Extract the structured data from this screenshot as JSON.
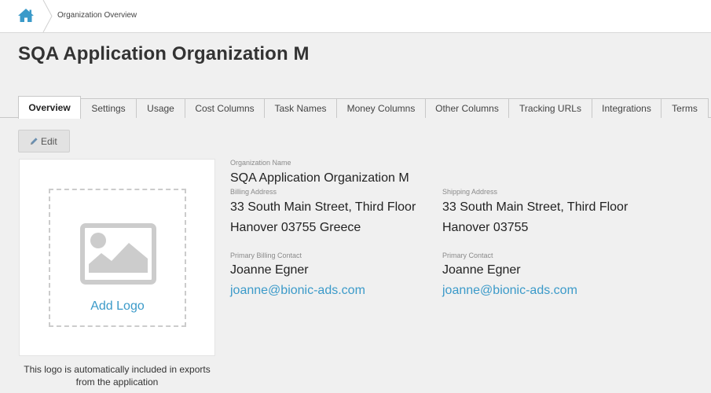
{
  "breadcrumb": {
    "home_icon": "home-icon",
    "current": "Organization Overview"
  },
  "page": {
    "title": "SQA Application Organization M"
  },
  "tabs": [
    {
      "label": "Overview",
      "active": true
    },
    {
      "label": "Settings"
    },
    {
      "label": "Usage"
    },
    {
      "label": "Cost Columns"
    },
    {
      "label": "Task Names"
    },
    {
      "label": "Money Columns"
    },
    {
      "label": "Other Columns"
    },
    {
      "label": "Tracking URLs"
    },
    {
      "label": "Integrations"
    },
    {
      "label": "Terms"
    }
  ],
  "toolbar": {
    "edit_label": "Edit",
    "edit_icon": "pencil-icon"
  },
  "logo": {
    "add_label": "Add Logo",
    "placeholder_icon": "image-icon",
    "note": "This logo is automatically included in exports from the application"
  },
  "organization": {
    "name_label": "Organization Name",
    "name": "SQA Application Organization M",
    "billing_label": "Billing Address",
    "billing_line1": "33 South Main Street, Third Floor",
    "billing_line2": "Hanover 03755 Greece",
    "shipping_label": "Shipping Address",
    "shipping_line1": "33 South Main Street, Third Floor",
    "shipping_line2": "Hanover 03755",
    "billing_contact_label": "Primary Billing Contact",
    "billing_contact_name": "Joanne Egner",
    "billing_contact_email": "joanne@bionic-ads.com",
    "primary_contact_label": "Primary Contact",
    "primary_contact_name": "Joanne Egner",
    "primary_contact_email": "joanne@bionic-ads.com"
  },
  "colors": {
    "accent": "#3b9ac9",
    "background": "#f0f0f0"
  }
}
